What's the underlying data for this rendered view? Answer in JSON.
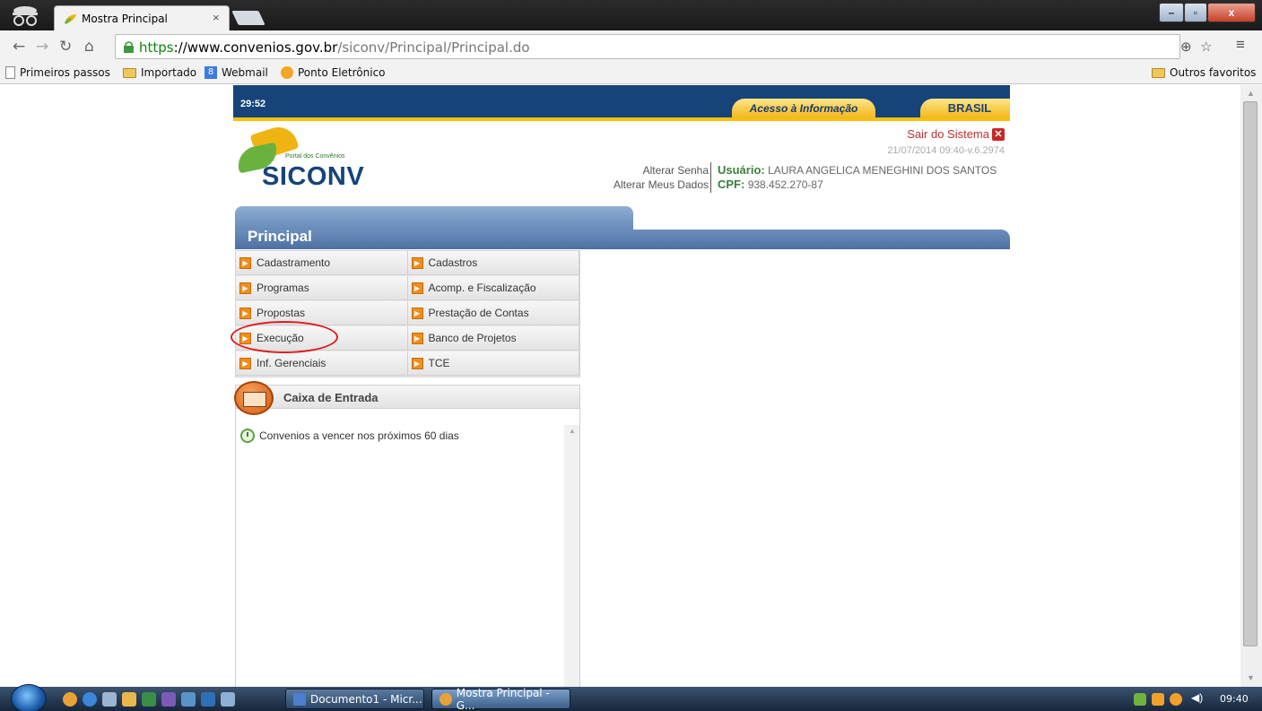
{
  "browser": {
    "tab_title": "Mostra Principal",
    "tab_close": "×",
    "url_scheme": "https",
    "url_host": "://www.convenios.gov.br",
    "url_path": "/siconv/Principal/Principal.do",
    "bookmarks": [
      {
        "label": "Primeiros passos"
      },
      {
        "label": "Importado"
      },
      {
        "label": "Webmail"
      },
      {
        "label": "Ponto Eletrônico"
      }
    ],
    "other_bookmarks": "Outros favoritos"
  },
  "site": {
    "session_timer": "29:52",
    "acesso_label": "Acesso à Informação",
    "brasil_label": "BRASIL",
    "portal_caption": "Portal dos Convênios",
    "logo_name": "SICONV",
    "logout_label": "Sair do Sistema",
    "version": "21/07/2014 09:40-v.6.2974",
    "change_password": "Alterar Senha",
    "change_data": "Alterar Meus Dados",
    "user_label": "Usuário:",
    "user_name": "LAURA ANGELICA MENEGHINI DOS SANTOS",
    "cpf_label": "CPF:",
    "cpf": "938.452.270-87",
    "section_title": "Principal",
    "menu": {
      "left": [
        "Cadastramento",
        "Programas",
        "Propostas",
        "Execução",
        "Inf. Gerenciais"
      ],
      "right": [
        "Cadastros",
        "Acomp. e Fiscalização",
        "Prestação de Contas",
        "Banco de Projetos",
        "TCE"
      ]
    },
    "inbox_title": "Caixa de Entrada",
    "inbox_item": "Convenios a vencer nos próximos 60 dias"
  },
  "taskbar": {
    "tasks": [
      "Documento1 - Micr...",
      "Mostra Principal - G..."
    ],
    "time": "09:40"
  },
  "colors": {
    "gov_blue": "#164479",
    "gov_yellow": "#f7c10b",
    "menu_arrow": "#f18e1b",
    "highlight_circle": "#e01b1b"
  }
}
